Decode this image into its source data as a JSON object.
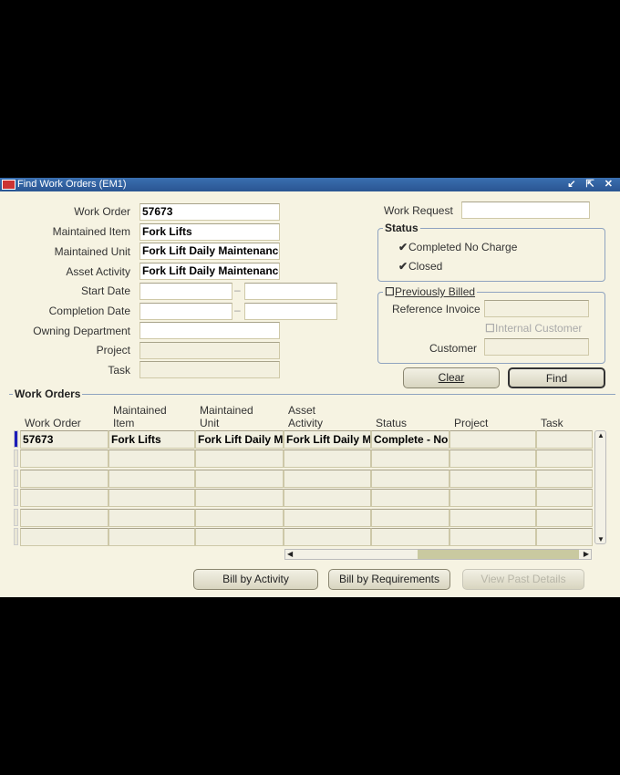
{
  "window": {
    "title": "Find Work Orders (EM1)",
    "controls": "↙ ⇱ ✕"
  },
  "form": {
    "work_order": {
      "label": "Work Order",
      "value": "57673"
    },
    "maintained_item": {
      "label": "Maintained Item",
      "value": "Fork Lifts"
    },
    "maintained_unit": {
      "label": "Maintained Unit",
      "value": "Fork Lift Daily Maintenance"
    },
    "asset_activity": {
      "label": "Asset Activity",
      "value": "Fork Lift Daily Maintenance"
    },
    "start_date": {
      "label": "Start Date",
      "dash": "–"
    },
    "completion_date": {
      "label": "Completion Date",
      "dash": "–"
    },
    "owning_department": {
      "label": "Owning Department"
    },
    "project": {
      "label": "Project"
    },
    "task": {
      "label": "Task"
    },
    "work_request": {
      "label": "Work Request"
    }
  },
  "status": {
    "legend": "Status",
    "completed_no_charge": {
      "label": "Completed No Charge",
      "checked": true
    },
    "closed": {
      "label": "Closed",
      "checked": true
    }
  },
  "billing": {
    "previously_billed": {
      "label": "Previously Billed",
      "checked": false
    },
    "reference_invoice": "Reference Invoice",
    "internal_customer": {
      "label": "Internal Customer",
      "checked": false
    },
    "customer": "Customer"
  },
  "buttons": {
    "clear": "Clear",
    "find": "Find",
    "bill_by_activity": "Bill by Activity",
    "bill_by_requirements": "Bill by Requirements",
    "view_past_details": "View Past Details"
  },
  "results": {
    "legend": "Work Orders",
    "columns": [
      [
        "",
        "Work Order"
      ],
      [
        "Maintained",
        "Item"
      ],
      [
        "Maintained",
        "Unit"
      ],
      [
        "Asset",
        "Activity"
      ],
      [
        "",
        "Status"
      ],
      [
        "",
        "Project"
      ],
      [
        "",
        "Task"
      ]
    ],
    "rows": [
      [
        "57673",
        "Fork Lifts",
        "Fork Lift Daily M",
        "Fork Lift Daily M",
        "Complete - No",
        "",
        ""
      ]
    ]
  }
}
